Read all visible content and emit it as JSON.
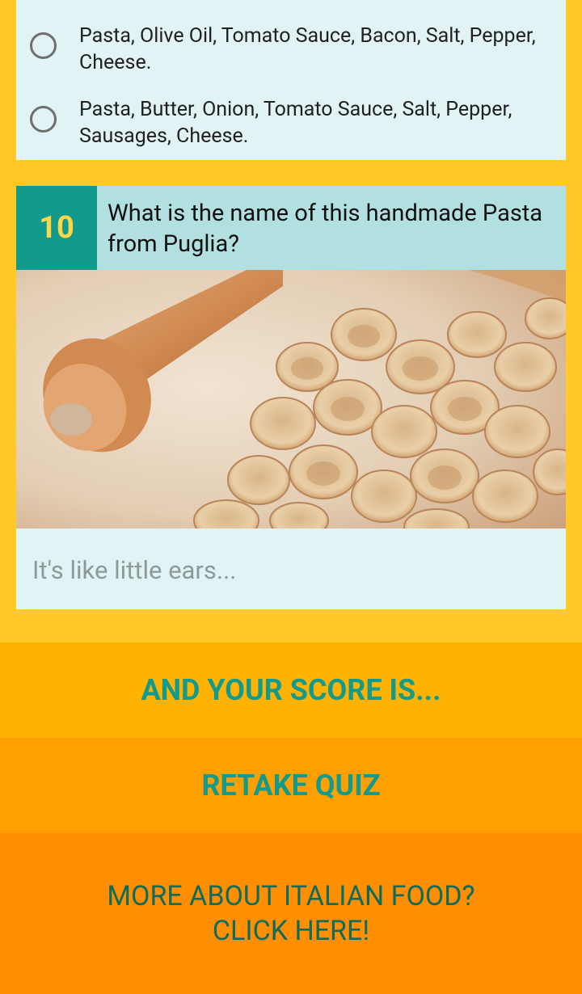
{
  "previous_question": {
    "options": [
      {
        "label": "Pasta, Olive Oil, Tomato Sauce, Bacon, Salt, Pepper, Cheese."
      },
      {
        "label": "Pasta, Butter, Onion, Tomato Sauce, Salt, Pepper, Sausages, Cheese."
      }
    ]
  },
  "question": {
    "number": "10",
    "text": "What is the name of this handmade Pasta from Puglia?",
    "image": "orecchiette pasta with wooden rolling pin on flour",
    "answer_placeholder": "It's like little ears..."
  },
  "actions": {
    "score_label": "AND YOUR SCORE IS...",
    "retake_label": "RETAKE QUIZ",
    "more_line1": "MORE ABOUT ITALIAN FOOD?",
    "more_line2": "CLICK HERE!"
  },
  "colors": {
    "background": "#FFC929",
    "card": "#E1F3F4",
    "number_bg": "#129A8C",
    "number_text": "#FFD54A",
    "question_bg": "#B2E0E0",
    "score_band": "#FFB300",
    "retake_band": "#FFA000",
    "more_band": "#FF8F00",
    "action_text": "#129A8C"
  }
}
